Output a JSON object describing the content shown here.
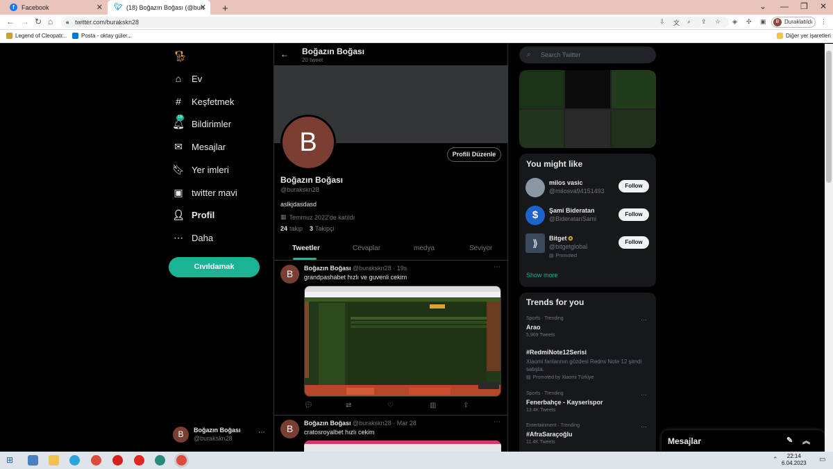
{
  "browser": {
    "tabs": [
      {
        "title": "Facebook",
        "active": false
      },
      {
        "title": "(18) Boğazın Boğası (@burakskn2",
        "active": true
      }
    ],
    "url": "twitter.com/burakskn28",
    "profile_label": "Duraklatıldı",
    "profile_initial": "B",
    "bookmarks": [
      {
        "label": "Legend of Cleopatr..."
      },
      {
        "label": "Posta - oktay güler..."
      }
    ],
    "other_bookmarks": "Diğer yer işaretleri"
  },
  "nav": {
    "items": [
      {
        "label": "Ev",
        "icon": "home-icon"
      },
      {
        "label": "Keşfetmek",
        "icon": "hashtag-icon"
      },
      {
        "label": "Bildirimler",
        "icon": "bell-icon",
        "badge": "18"
      },
      {
        "label": "Mesajlar",
        "icon": "mail-icon"
      },
      {
        "label": "Yer imleri",
        "icon": "bookmark-icon"
      },
      {
        "label": "twitter mavi",
        "icon": "twitter-blue-icon"
      },
      {
        "label": "Profil",
        "icon": "person-icon"
      },
      {
        "label": "Daha",
        "icon": "more-circle-icon"
      }
    ],
    "tweet_button": "Cıvıldamak",
    "account": {
      "name": "Boğazın Boğası",
      "handle": "@burakskn28",
      "initial": "B"
    }
  },
  "profile": {
    "header_name": "Boğazın Boğası",
    "tweet_count": "20 tweet",
    "avatar_initial": "B",
    "edit_button": "Profili Düzenle",
    "display_name": "Boğazın Boğası",
    "handle": "@burakskn28",
    "bio": "aslkjdasdasd",
    "joined": "Temmuz 2022'de katıldı",
    "following_count": "24",
    "following_label": "takip",
    "followers_count": "3",
    "followers_label": "Takipçi",
    "tabs": [
      "Tweetler",
      "Cevaplar",
      "medya",
      "Seviyor"
    ]
  },
  "tweets": [
    {
      "name": "Boğazın Boğası",
      "meta": "@burakskn28 · 19s",
      "text": "grandpashabet hızlı ve guvenli cekim"
    },
    {
      "name": "Boğazın Boğası",
      "meta": "@burakskn28 · Mar 28",
      "text": "cratosroyalbet hızlı cekim"
    }
  ],
  "right": {
    "search_placeholder": "Search Twitter",
    "you_might_like": "You might like",
    "suggestions": [
      {
        "name": "milos vasic",
        "handle": "@milosva94151493",
        "follow": "Follow"
      },
      {
        "name": "Şami Bideratan",
        "handle": "@BideratanSami",
        "follow": "Follow"
      },
      {
        "name": "Bitget",
        "handle": "@bitgetglobal",
        "promoted": "Promoted",
        "follow": "Follow"
      }
    ],
    "show_more": "Show more",
    "trends_title": "Trends for you",
    "trends": [
      {
        "category": "Sports · Trending",
        "name": "Arao",
        "count": "5,969 Tweets"
      },
      {
        "category": "",
        "name": "#RedmiNote12Serisi",
        "desc": "Xiaomi fanlarının gözdesi Redmi Note 12 şimdi satışta.",
        "promoted": "Promoted by Xiaomi Türkiye"
      },
      {
        "category": "Sports · Trending",
        "name": "Fenerbahçe - Kayserispor",
        "count": "13.4K Tweets"
      },
      {
        "category": "Entertainment · Trending",
        "name": "#AfraSaraçoğlu",
        "count": "11.4K Tweets"
      }
    ],
    "messages_drawer": "Mesajlar"
  },
  "taskbar": {
    "time": "22:14",
    "date": "6.04.2023"
  },
  "colors": {
    "accent": "#1ab394",
    "background": "#000000",
    "card": "#16181c",
    "avatar": "#7a3e33"
  }
}
